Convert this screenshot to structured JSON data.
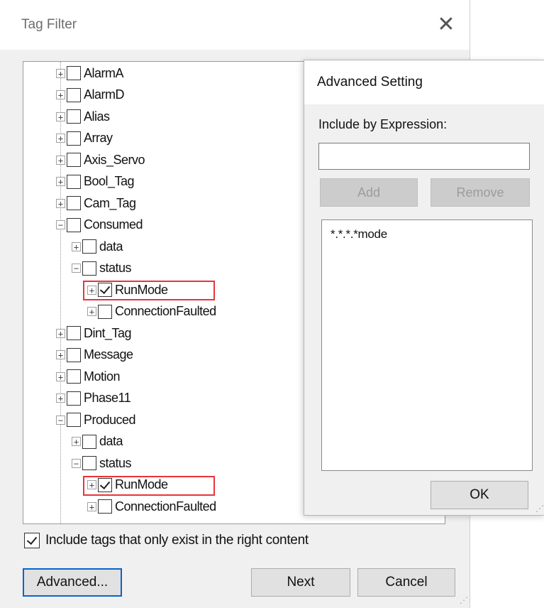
{
  "dialog": {
    "title": "Tag Filter",
    "close_glyph": "✕",
    "include_checkbox_label": "Include tags that only exist in the right content",
    "include_checked": true,
    "buttons": {
      "advanced": "Advanced...",
      "next": "Next",
      "cancel": "Cancel"
    }
  },
  "tree": {
    "items": [
      {
        "label": "AlarmA",
        "expander": "+",
        "checked": false,
        "level": 0
      },
      {
        "label": "AlarmD",
        "expander": "+",
        "checked": false,
        "level": 0
      },
      {
        "label": "Alias",
        "expander": "+",
        "checked": false,
        "level": 0
      },
      {
        "label": "Array",
        "expander": "+",
        "checked": false,
        "level": 0
      },
      {
        "label": "Axis_Servo",
        "expander": "+",
        "checked": false,
        "level": 0
      },
      {
        "label": "Bool_Tag",
        "expander": "+",
        "checked": false,
        "level": 0
      },
      {
        "label": "Cam_Tag",
        "expander": "+",
        "checked": false,
        "level": 0
      },
      {
        "label": "Consumed",
        "expander": "−",
        "checked": false,
        "level": 0
      },
      {
        "label": "data",
        "expander": "+",
        "checked": false,
        "level": 1
      },
      {
        "label": "status",
        "expander": "−",
        "checked": false,
        "level": 1
      },
      {
        "label": "RunMode",
        "expander": "+",
        "checked": true,
        "level": 2,
        "highlighted": true
      },
      {
        "label": "ConnectionFaulted",
        "expander": "+",
        "checked": false,
        "level": 2
      },
      {
        "label": "Dint_Tag",
        "expander": "+",
        "checked": false,
        "level": 0
      },
      {
        "label": "Message",
        "expander": "+",
        "checked": false,
        "level": 0
      },
      {
        "label": "Motion",
        "expander": "+",
        "checked": false,
        "level": 0
      },
      {
        "label": "Phase11",
        "expander": "+",
        "checked": false,
        "level": 0
      },
      {
        "label": "Produced",
        "expander": "−",
        "checked": false,
        "level": 0
      },
      {
        "label": "data",
        "expander": "+",
        "checked": false,
        "level": 1
      },
      {
        "label": "status",
        "expander": "−",
        "checked": false,
        "level": 1
      },
      {
        "label": "RunMode",
        "expander": "+",
        "checked": true,
        "level": 2,
        "highlighted": true
      },
      {
        "label": "ConnectionFaulted",
        "expander": "+",
        "checked": false,
        "level": 2
      }
    ]
  },
  "advanced_setting": {
    "title": "Advanced Setting",
    "expression_label": "Include by Expression:",
    "expression_value": "",
    "add_label": "Add",
    "remove_label": "Remove",
    "expressions": [
      "*.*.*.*mode"
    ],
    "ok_label": "OK"
  },
  "colors": {
    "highlight_border": "#e8343a",
    "focus_border": "#0a64c8",
    "dialog_bg": "#f0f0f0"
  }
}
